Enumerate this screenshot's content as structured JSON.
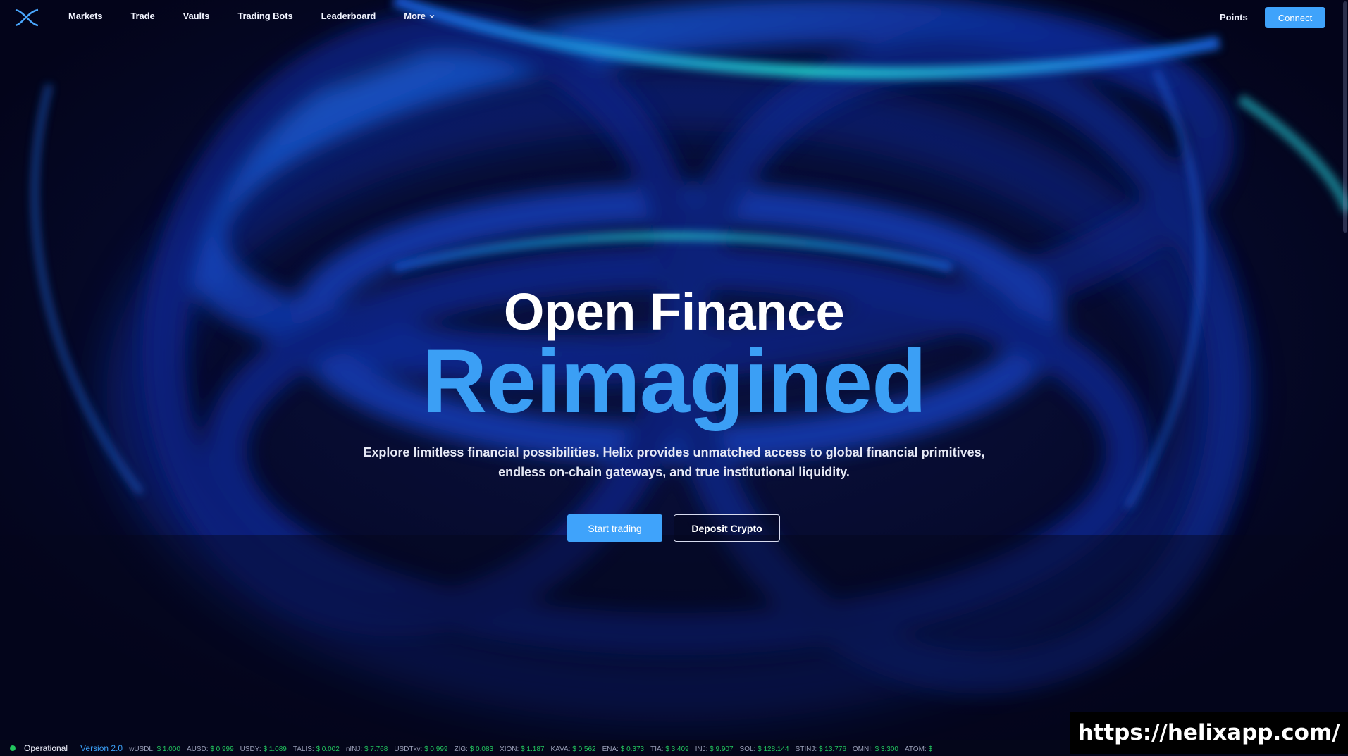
{
  "nav": {
    "logo_icon": "helix-logo-icon",
    "items": [
      {
        "label": "Markets"
      },
      {
        "label": "Trade"
      },
      {
        "label": "Vaults"
      },
      {
        "label": "Trading Bots"
      },
      {
        "label": "Leaderboard"
      },
      {
        "label": "More"
      }
    ],
    "points_label": "Points",
    "connect_label": "Connect"
  },
  "hero": {
    "title_line1": "Open Finance",
    "title_line2": "Reimagined",
    "subtitle_line1": "Explore limitless financial possibilities. Helix provides unmatched access to global financial primitives,",
    "subtitle_line2": "endless on-chain gateways, and true institutional liquidity.",
    "primary_cta": "Start trading",
    "secondary_cta": "Deposit Crypto"
  },
  "status_bar": {
    "status": "Operational",
    "version": "Version 2.0",
    "tickers": [
      {
        "symbol": "wUSDL:",
        "price": "$ 1.000"
      },
      {
        "symbol": "AUSD:",
        "price": "$ 0.999"
      },
      {
        "symbol": "USDY:",
        "price": "$ 1.089"
      },
      {
        "symbol": "TALIS:",
        "price": "$ 0.002"
      },
      {
        "symbol": "nINJ:",
        "price": "$ 7.768"
      },
      {
        "symbol": "USDTkv:",
        "price": "$ 0.999"
      },
      {
        "symbol": "ZIG:",
        "price": "$ 0.083"
      },
      {
        "symbol": "XION:",
        "price": "$ 1.187"
      },
      {
        "symbol": "KAVA:",
        "price": "$ 0.562"
      },
      {
        "symbol": "ENA:",
        "price": "$ 0.373"
      },
      {
        "symbol": "TIA:",
        "price": "$ 3.409"
      },
      {
        "symbol": "INJ:",
        "price": "$ 9.907"
      },
      {
        "symbol": "SOL:",
        "price": "$ 128.144"
      },
      {
        "symbol": "STINJ:",
        "price": "$ 13.776"
      },
      {
        "symbol": "OMNI:",
        "price": "$ 3.300"
      },
      {
        "symbol": "ATOM:",
        "price": "$"
      }
    ]
  },
  "watermark": "https://helixapp.com/",
  "colors": {
    "accent": "#3fa3fb",
    "hero_blue": "#3b9ff5",
    "background": "#04061c",
    "positive": "#22c55e"
  }
}
